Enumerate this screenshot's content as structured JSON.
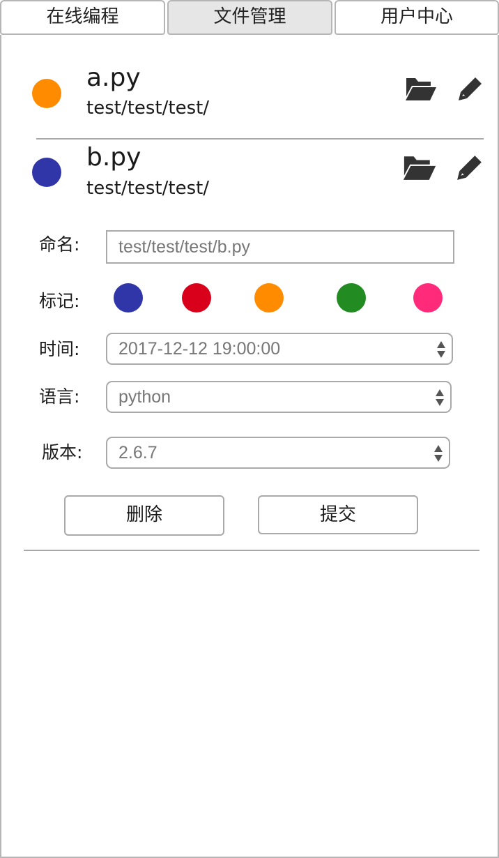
{
  "tabs": [
    {
      "label": "在线编程",
      "active": false
    },
    {
      "label": "文件管理",
      "active": true
    },
    {
      "label": "用户中心",
      "active": false
    }
  ],
  "files": [
    {
      "name": "a.py",
      "path": "test/test/test/",
      "color": "#ff8c00",
      "icons": [
        "folder-open-icon",
        "pencil-icon"
      ]
    },
    {
      "name": "b.py",
      "path": "test/test/test/",
      "color": "#3035a8",
      "icons": [
        "folder-open-icon",
        "pencil-icon"
      ]
    }
  ],
  "form": {
    "name_label": "命名:",
    "name_value": "test/test/test/b.py",
    "mark_label": "标记:",
    "mark_colors": [
      "#3035a8",
      "#d9001b",
      "#ff8c00",
      "#228b22",
      "#ff2a7a"
    ],
    "time_label": "时间:",
    "time_value": "2017-12-12 19:00:00",
    "lang_label": "语言:",
    "lang_value": "python",
    "version_label": "版本:",
    "version_value": "2.6.7",
    "delete_label": "删除",
    "submit_label": "提交"
  },
  "colors": {
    "border": "#b5b5b5",
    "active_tab_bg": "#e6e6e6",
    "icon": "#333333"
  }
}
